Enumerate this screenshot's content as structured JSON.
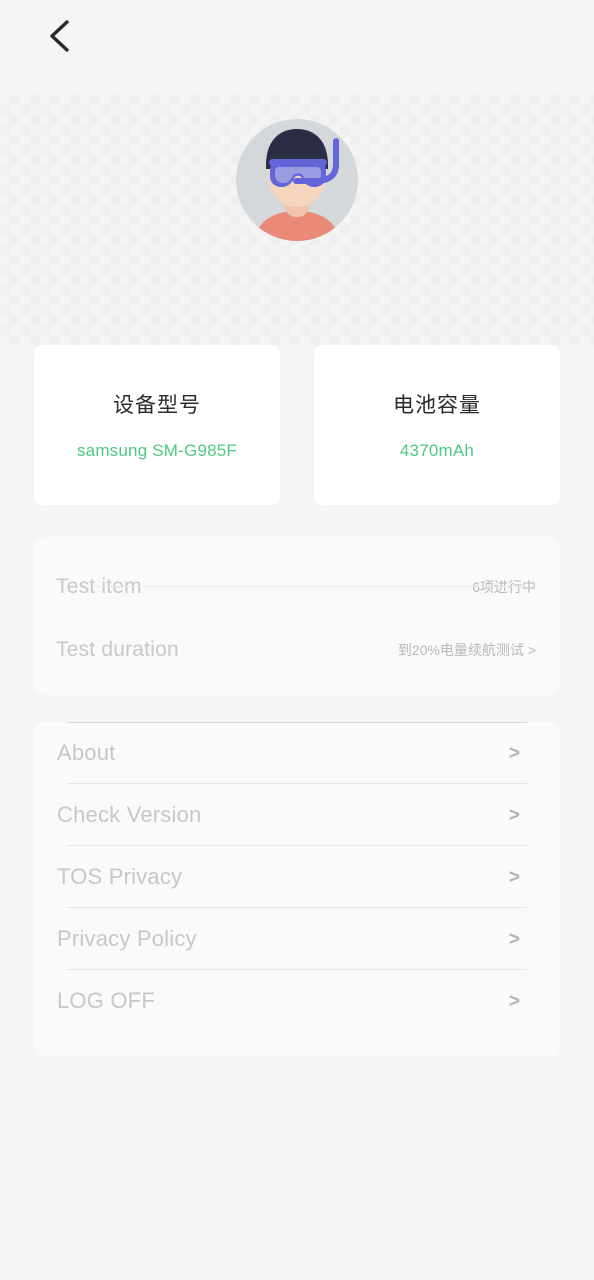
{
  "screen": {
    "background_color": "#f5f5f5",
    "accent_green": "#4ec97f"
  },
  "topbar": {
    "back_icon": "chevron-left-icon"
  },
  "avatar": {
    "icon": "scuba-diver-avatar",
    "circle_color": "#d4d8da",
    "hair_color": "#2b2d45",
    "goggles_color": "#6366d8",
    "skin_color": "#f6d5bf",
    "shirt_color": "#e98a78"
  },
  "info_cards": [
    {
      "title": "设备型号",
      "value": "samsung SM-G985F"
    },
    {
      "title": "电池容量",
      "value": "4370mAh"
    }
  ],
  "test_panel": {
    "rows": [
      {
        "label": "Test item",
        "value": "6项进行中"
      },
      {
        "label": "Test duration",
        "value": "到20%电量续航测试 >"
      }
    ]
  },
  "menu_panel": {
    "items": [
      {
        "label": "About",
        "chevron": ">"
      },
      {
        "label": "Check Version",
        "chevron": ">"
      },
      {
        "label": "TOS Privacy",
        "chevron": ">"
      },
      {
        "label": "Privacy Policy",
        "chevron": ">"
      },
      {
        "label": "LOG OFF",
        "chevron": ">"
      }
    ]
  }
}
